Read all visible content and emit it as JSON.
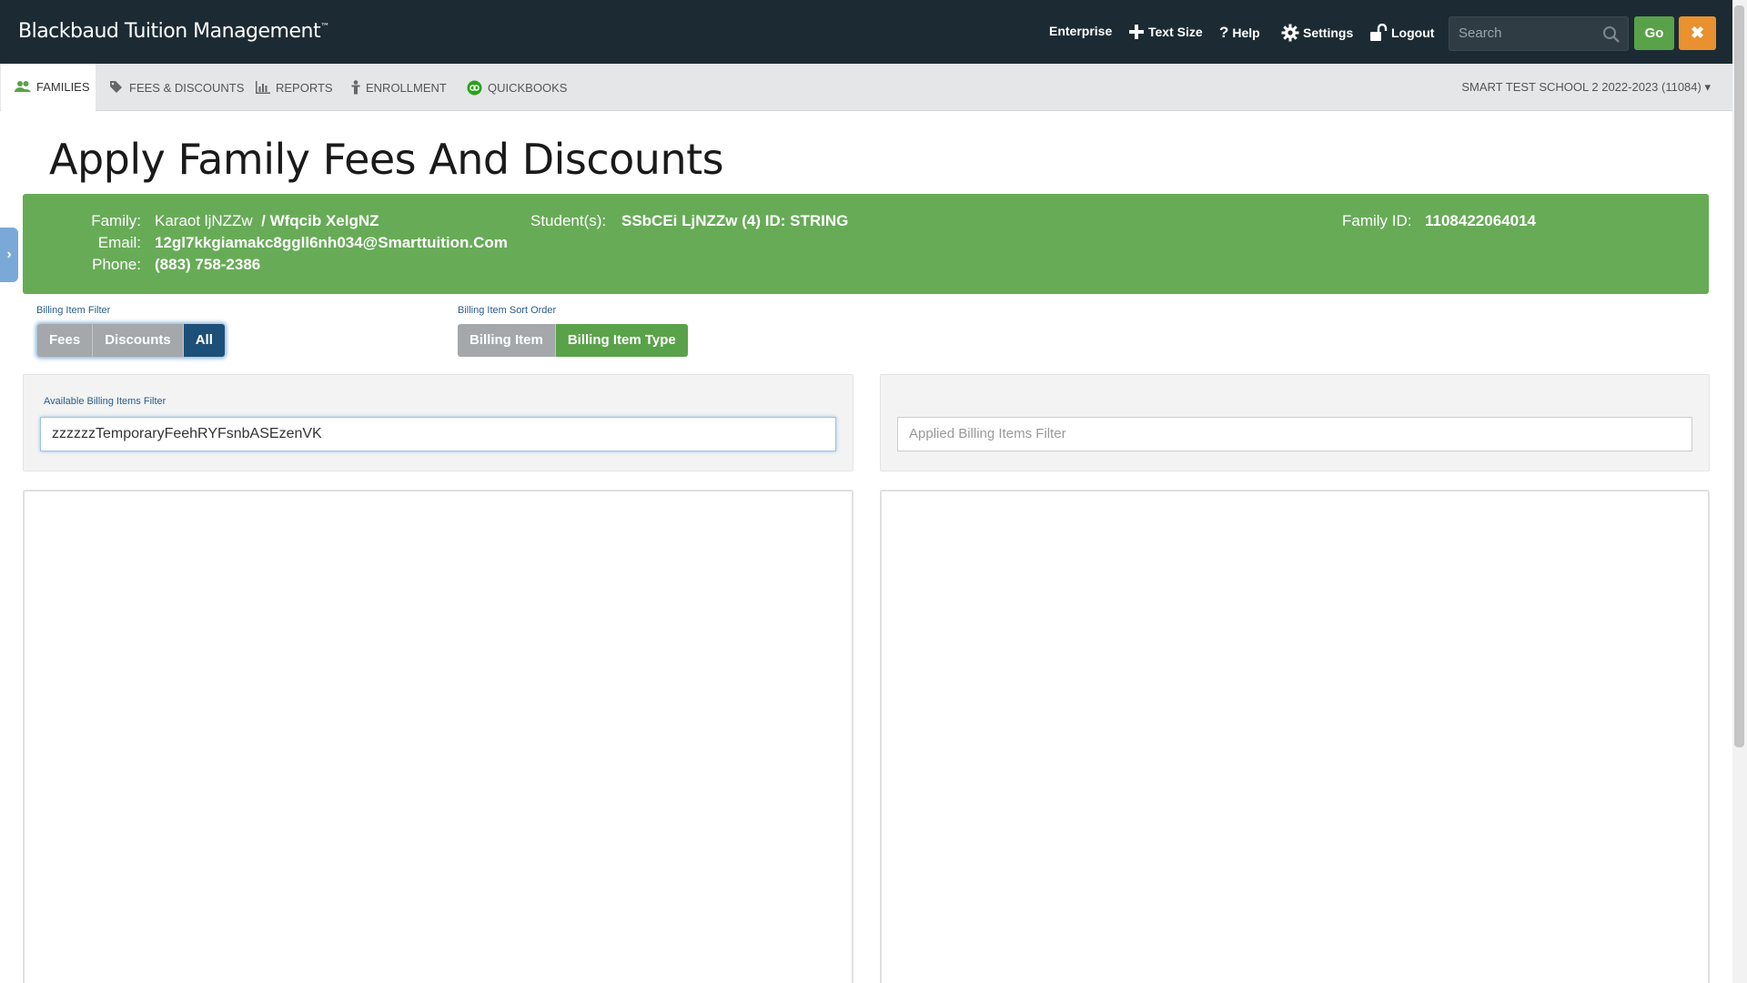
{
  "header": {
    "brand": "Blackbaud Tuition Management",
    "brand_tm": "™",
    "nav": {
      "enterprise": "Enterprise",
      "text_size": "Text Size",
      "help": "Help",
      "settings": "Settings",
      "logout": "Logout"
    },
    "search_placeholder": "Search",
    "go_label": "Go",
    "close_label": "✖"
  },
  "subnav": {
    "tabs": [
      {
        "label": "FAMILIES",
        "icon": "users-icon",
        "active": true
      },
      {
        "label": "FEES & DISCOUNTS",
        "icon": "tags-icon"
      },
      {
        "label": "REPORTS",
        "icon": "bar-chart-icon"
      },
      {
        "label": "ENROLLMENT",
        "icon": "person-icon"
      },
      {
        "label": "QUICKBOOKS",
        "icon": "quickbooks-icon"
      }
    ],
    "school": "SMART TEST SCHOOL 2 2022-2023 (11084)"
  },
  "page": {
    "title": "Apply Family Fees And Discounts"
  },
  "family_info": {
    "family_label": "Family:",
    "family_name": "Karaot ljNZZw",
    "family_name2": "/ Wfqcib XelgNZ",
    "email_label": "Email:",
    "email": "12gl7kkgiamakc8ggll6nh034@Smarttuition.Com",
    "phone_label": "Phone:",
    "phone": "(883) 758-2386",
    "students_label": "Student(s):",
    "students": "SSbCEi LjNZZw (4) ID: STRING",
    "family_id_label": "Family ID:",
    "family_id": "1108422064014"
  },
  "billing_filter": {
    "label": "Billing Item Filter",
    "options": [
      "Fees",
      "Discounts",
      "All"
    ],
    "selected": "All"
  },
  "sort_order": {
    "label": "Billing Item Sort Order",
    "options": [
      "Billing Item",
      "Billing Item Type"
    ],
    "selected": "Billing Item Type"
  },
  "available": {
    "label": "Available Billing Items Filter",
    "value": "zzzzzzTemporaryFeehRYFsnbASEzenVK"
  },
  "applied": {
    "placeholder": "Applied Billing Items Filter"
  },
  "colors": {
    "header_bg": "#1c2b33",
    "info_green": "#67ab57",
    "go_green": "#5aa24a",
    "close_orange": "#e9902f",
    "selected_blue": "#1d4f78"
  }
}
